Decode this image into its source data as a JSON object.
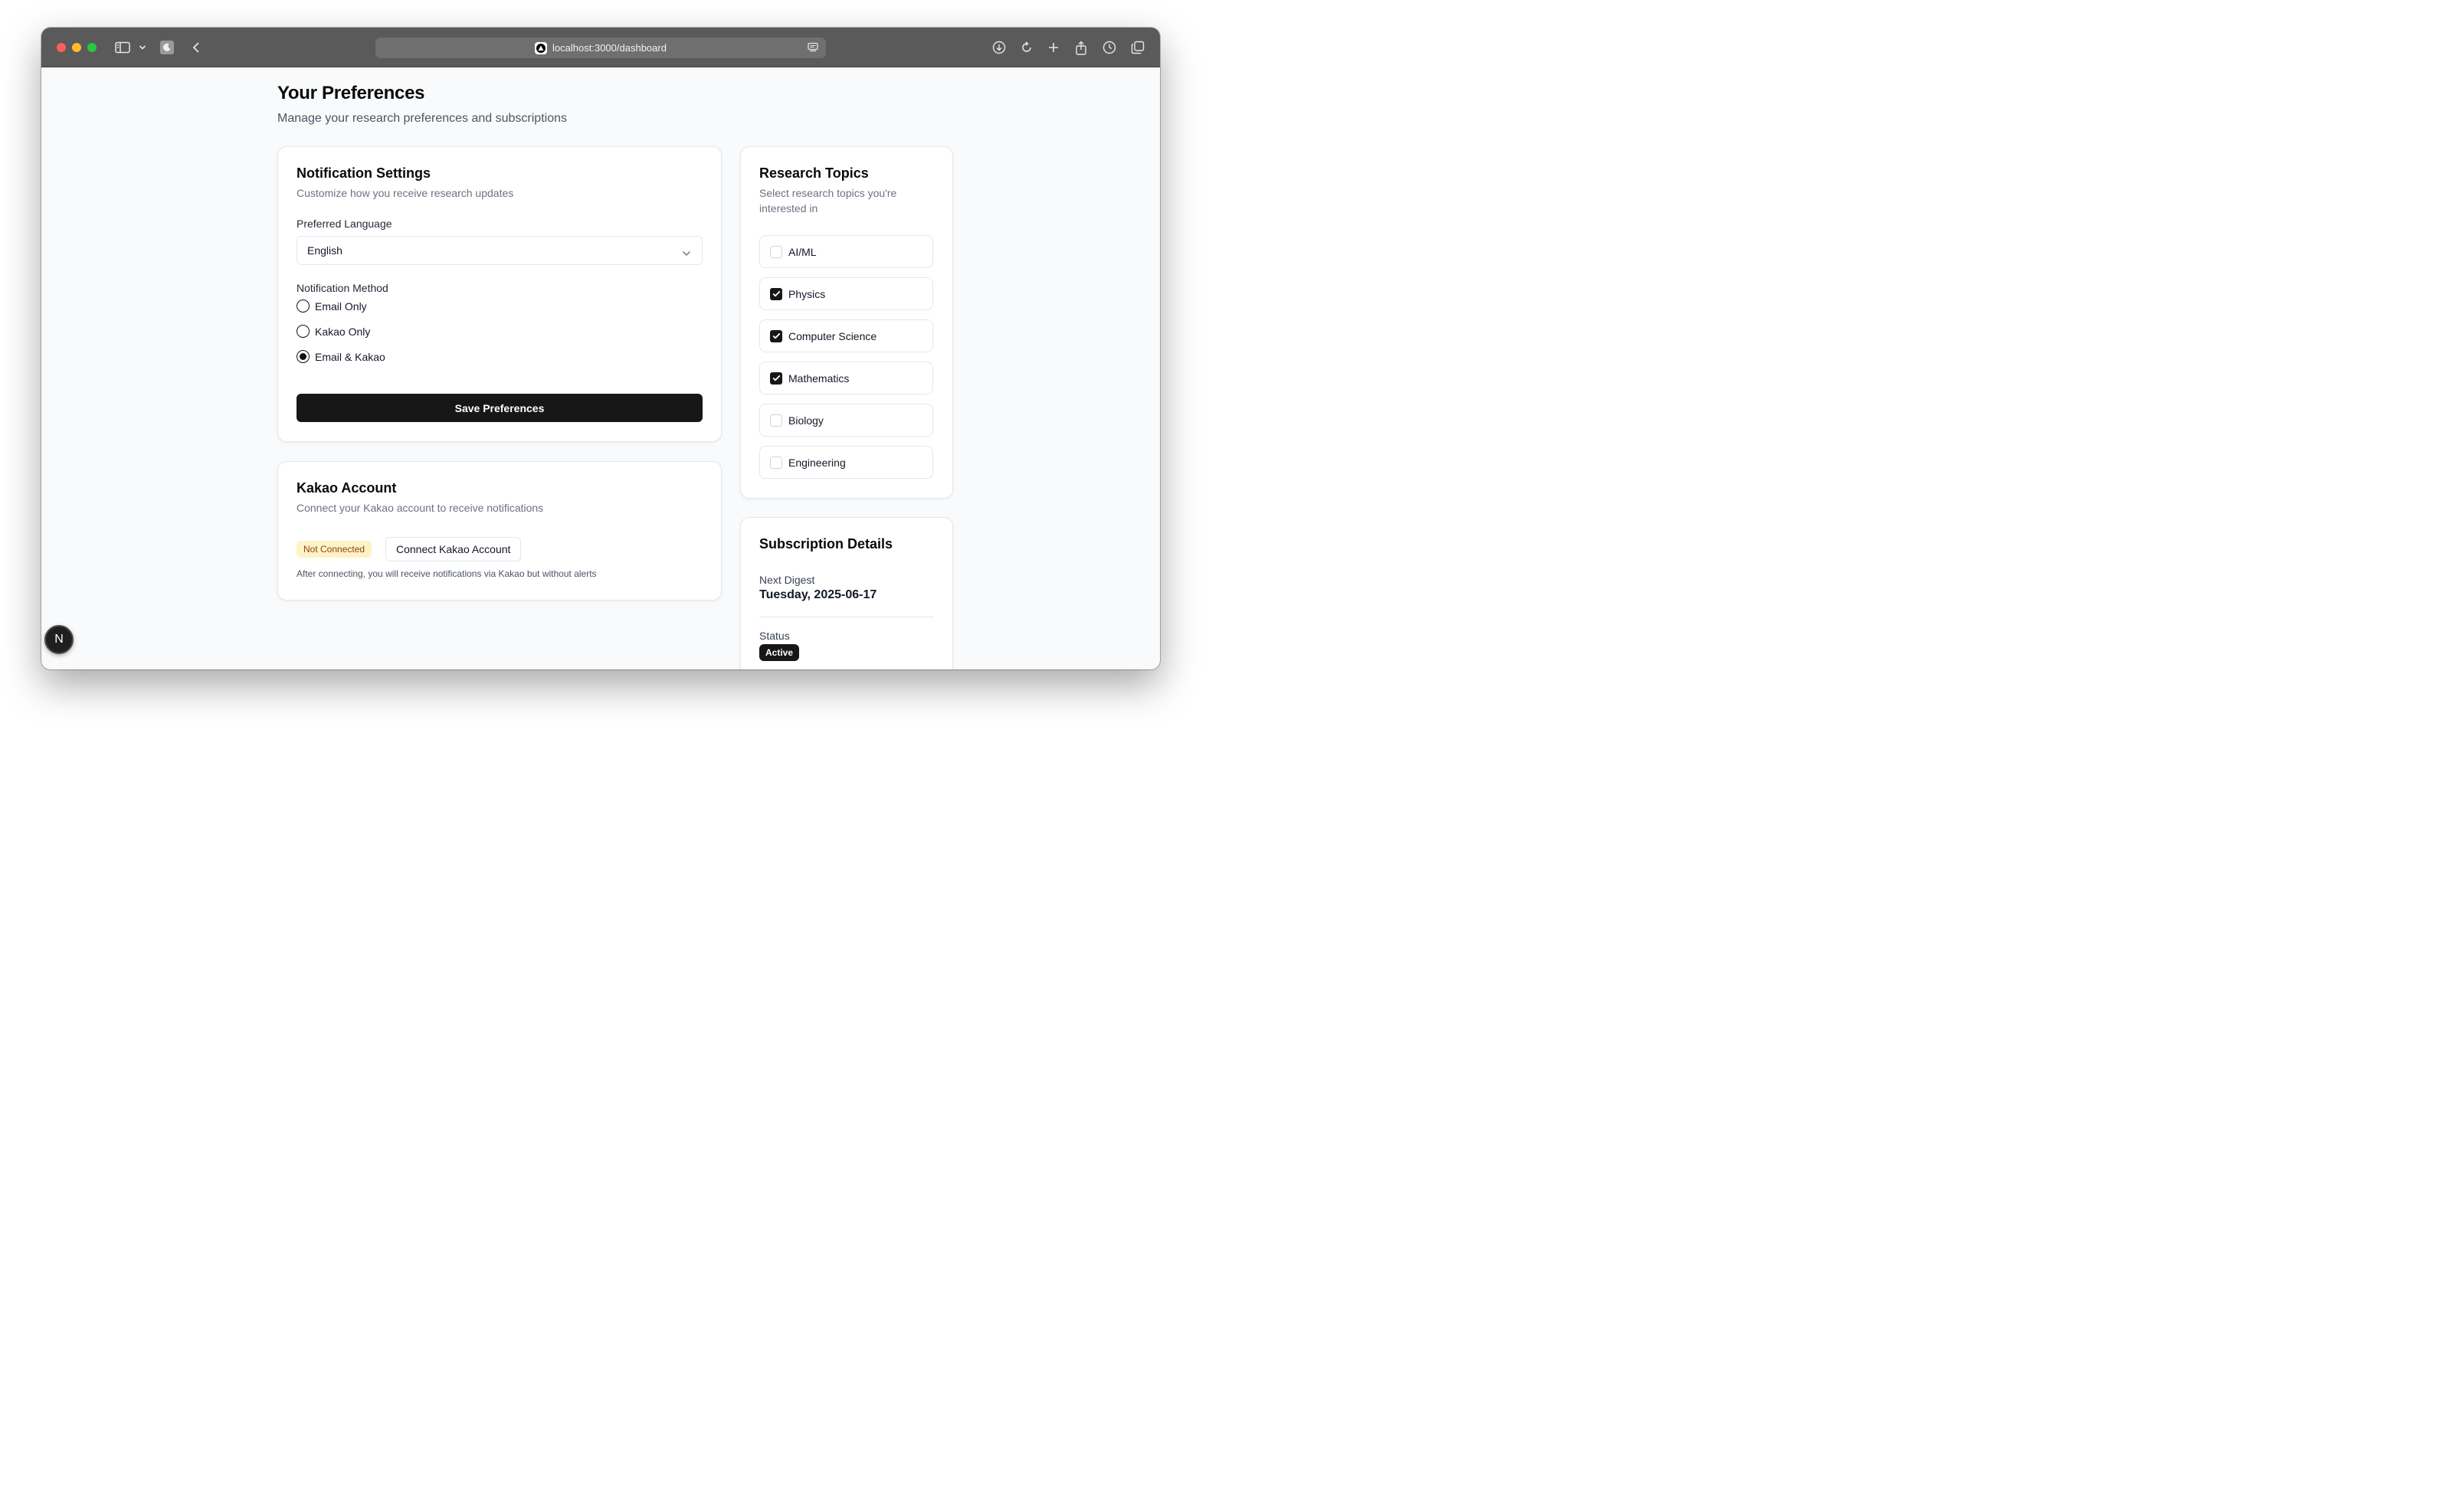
{
  "browser": {
    "url": "localhost:3000/dashboard"
  },
  "page": {
    "title": "Your Preferences",
    "subtitle": "Manage your research preferences and subscriptions"
  },
  "notification_settings": {
    "title": "Notification Settings",
    "subtitle": "Customize how you receive research updates",
    "language_label": "Preferred Language",
    "language_value": "English",
    "method_label": "Notification Method",
    "methods": [
      {
        "label": "Email Only",
        "selected": false
      },
      {
        "label": "Kakao Only",
        "selected": false
      },
      {
        "label": "Email & Kakao",
        "selected": true
      }
    ],
    "save_label": "Save Preferences"
  },
  "kakao_account": {
    "title": "Kakao Account",
    "subtitle": "Connect your Kakao account to receive notifications",
    "status_badge": "Not Connected",
    "connect_label": "Connect Kakao Account",
    "note": "After connecting, you will receive notifications via Kakao but without alerts"
  },
  "research_topics": {
    "title": "Research Topics",
    "subtitle": "Select research topics you're interested in",
    "topics": [
      {
        "label": "AI/ML",
        "checked": false
      },
      {
        "label": "Physics",
        "checked": true
      },
      {
        "label": "Computer Science",
        "checked": true
      },
      {
        "label": "Mathematics",
        "checked": true
      },
      {
        "label": "Biology",
        "checked": false
      },
      {
        "label": "Engineering",
        "checked": false
      }
    ]
  },
  "subscription_details": {
    "title": "Subscription Details",
    "next_digest_label": "Next Digest",
    "next_digest_value": "Tuesday, 2025-06-17",
    "status_label": "Status",
    "status_value": "Active"
  },
  "dev_badge": {
    "letter": "N"
  }
}
